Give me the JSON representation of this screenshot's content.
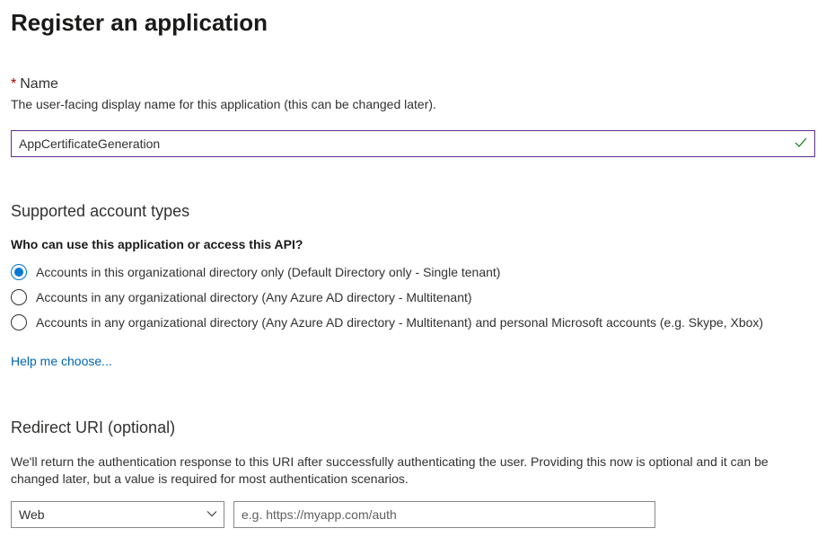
{
  "page": {
    "title": "Register an application"
  },
  "name_section": {
    "label": "Name",
    "required_marker": "*",
    "description": "The user-facing display name for this application (this can be changed later).",
    "value": "AppCertificateGeneration"
  },
  "account_types": {
    "heading": "Supported account types",
    "question": "Who can use this application or access this API?",
    "options": [
      {
        "label": "Accounts in this organizational directory only (Default Directory only - Single tenant)",
        "selected": true
      },
      {
        "label": "Accounts in any organizational directory (Any Azure AD directory - Multitenant)",
        "selected": false
      },
      {
        "label": "Accounts in any organizational directory (Any Azure AD directory - Multitenant) and personal Microsoft accounts (e.g. Skype, Xbox)",
        "selected": false
      }
    ],
    "help_link": "Help me choose..."
  },
  "redirect": {
    "heading": "Redirect URI (optional)",
    "description": "We'll return the authentication response to this URI after successfully authenticating the user. Providing this now is optional and it can be changed later, but a value is required for most authentication scenarios.",
    "platform_selected": "Web",
    "uri_placeholder": "e.g. https://myapp.com/auth",
    "uri_value": ""
  }
}
